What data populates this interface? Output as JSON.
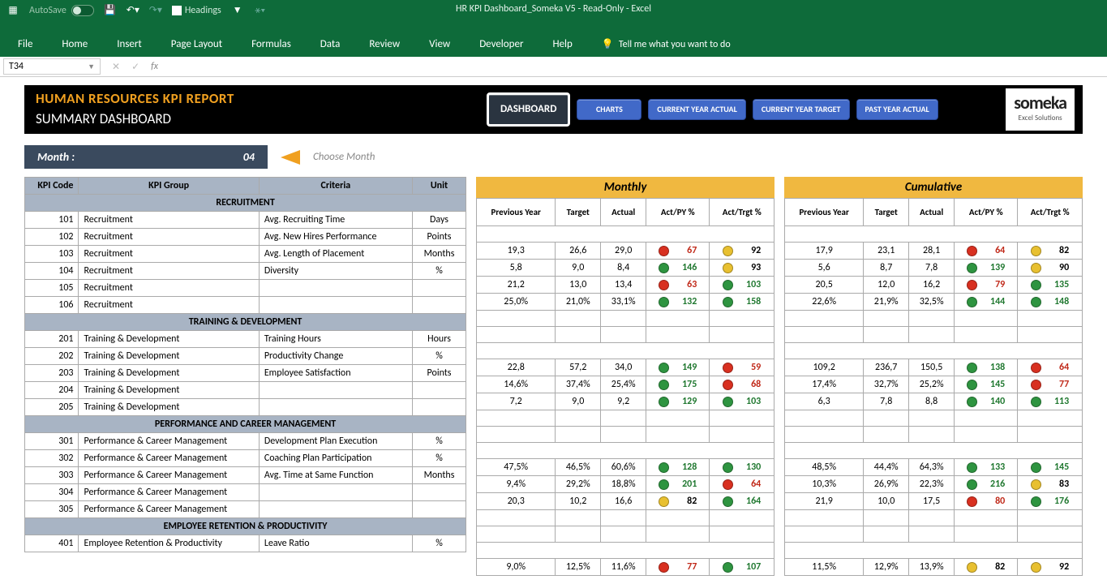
{
  "app": {
    "title": "HR KPI Dashboard_Someka V5  -  Read-Only  -  Excel",
    "autosave": "AutoSave",
    "headings": "Headings",
    "nameBox": "T34",
    "tellMe": "Tell me what you want to do"
  },
  "tabs": [
    "File",
    "Home",
    "Insert",
    "Page Layout",
    "Formulas",
    "Data",
    "Review",
    "View",
    "Developer",
    "Help"
  ],
  "report": {
    "title": "HUMAN RESOURCES KPI REPORT",
    "subtitle": "SUMMARY DASHBOARD"
  },
  "nav": [
    "DASHBOARD",
    "CHARTS",
    "CURRENT YEAR ACTUAL",
    "CURRENT YEAR TARGET",
    "PAST YEAR ACTUAL"
  ],
  "logo": {
    "main": "someka",
    "sub": "Excel Solutions"
  },
  "month": {
    "label": "Month :",
    "value": "04",
    "hint": "Choose Month"
  },
  "cols": {
    "kpiCode": "KPI Code",
    "kpiGroup": "KPI Group",
    "criteria": "Criteria",
    "unit": "Unit",
    "prev": "Previous Year",
    "target": "Target",
    "actual": "Actual",
    "actPy": "Act/PY %",
    "actTrgt": "Act/Trgt %"
  },
  "sections": {
    "monthly": "Monthly",
    "cumulative": "Cumulative"
  },
  "groups": [
    {
      "name": "RECRUITMENT",
      "rows": [
        {
          "code": "101",
          "group": "Recruitment",
          "crit": "Avg. Recruiting Time",
          "unit": "Days",
          "m": {
            "prev": "19,3",
            "target": "26,6",
            "actual": "29,0",
            "py": {
              "v": "67",
              "c": "red",
              "d": "red"
            },
            "tr": {
              "v": "92",
              "c": "black",
              "d": "yellow"
            }
          },
          "c": {
            "prev": "17,9",
            "target": "23,1",
            "actual": "28,1",
            "py": {
              "v": "64",
              "c": "red",
              "d": "red"
            },
            "tr": {
              "v": "82",
              "c": "black",
              "d": "yellow"
            }
          }
        },
        {
          "code": "102",
          "group": "Recruitment",
          "crit": "Avg. New Hires Performance",
          "unit": "Points",
          "m": {
            "prev": "5,8",
            "target": "9,0",
            "actual": "8,4",
            "py": {
              "v": "146",
              "c": "green",
              "d": "green"
            },
            "tr": {
              "v": "93",
              "c": "black",
              "d": "yellow"
            }
          },
          "c": {
            "prev": "5,6",
            "target": "8,7",
            "actual": "7,8",
            "py": {
              "v": "139",
              "c": "green",
              "d": "green"
            },
            "tr": {
              "v": "90",
              "c": "black",
              "d": "yellow"
            }
          }
        },
        {
          "code": "103",
          "group": "Recruitment",
          "crit": "Avg. Length of Placement",
          "unit": "Months",
          "m": {
            "prev": "21,2",
            "target": "13,0",
            "actual": "13,4",
            "py": {
              "v": "63",
              "c": "red",
              "d": "red"
            },
            "tr": {
              "v": "103",
              "c": "green",
              "d": "green"
            }
          },
          "c": {
            "prev": "20,5",
            "target": "12,0",
            "actual": "16,2",
            "py": {
              "v": "79",
              "c": "red",
              "d": "red"
            },
            "tr": {
              "v": "135",
              "c": "green",
              "d": "green"
            }
          }
        },
        {
          "code": "104",
          "group": "Recruitment",
          "crit": "Diversity",
          "unit": "%",
          "m": {
            "prev": "25,0%",
            "target": "21,0%",
            "actual": "33,1%",
            "py": {
              "v": "132",
              "c": "green",
              "d": "green"
            },
            "tr": {
              "v": "158",
              "c": "green",
              "d": "green"
            }
          },
          "c": {
            "prev": "22,6%",
            "target": "21,9%",
            "actual": "32,5%",
            "py": {
              "v": "144",
              "c": "green",
              "d": "green"
            },
            "tr": {
              "v": "148",
              "c": "green",
              "d": "green"
            }
          }
        },
        {
          "code": "105",
          "group": "Recruitment",
          "crit": "",
          "unit": "",
          "m": null,
          "c": null
        },
        {
          "code": "106",
          "group": "Recruitment",
          "crit": "",
          "unit": "",
          "m": null,
          "c": null
        }
      ]
    },
    {
      "name": "TRAINING & DEVELOPMENT",
      "rows": [
        {
          "code": "201",
          "group": "Training & Development",
          "crit": "Training Hours",
          "unit": "Hours",
          "m": {
            "prev": "22,8",
            "target": "57,2",
            "actual": "34,0",
            "py": {
              "v": "149",
              "c": "green",
              "d": "green"
            },
            "tr": {
              "v": "59",
              "c": "red",
              "d": "red"
            }
          },
          "c": {
            "prev": "109,2",
            "target": "236,7",
            "actual": "150,5",
            "py": {
              "v": "138",
              "c": "green",
              "d": "green"
            },
            "tr": {
              "v": "64",
              "c": "red",
              "d": "red"
            }
          }
        },
        {
          "code": "202",
          "group": "Training & Development",
          "crit": "Productivity Change",
          "unit": "%",
          "m": {
            "prev": "14,6%",
            "target": "37,4%",
            "actual": "25,4%",
            "py": {
              "v": "175",
              "c": "green",
              "d": "green"
            },
            "tr": {
              "v": "68",
              "c": "red",
              "d": "red"
            }
          },
          "c": {
            "prev": "17,4%",
            "target": "32,7%",
            "actual": "25,2%",
            "py": {
              "v": "145",
              "c": "green",
              "d": "green"
            },
            "tr": {
              "v": "77",
              "c": "red",
              "d": "red"
            }
          }
        },
        {
          "code": "203",
          "group": "Training & Development",
          "crit": "Employee Satisfaction",
          "unit": "Points",
          "m": {
            "prev": "7,2",
            "target": "9,0",
            "actual": "9,2",
            "py": {
              "v": "129",
              "c": "green",
              "d": "green"
            },
            "tr": {
              "v": "103",
              "c": "green",
              "d": "green"
            }
          },
          "c": {
            "prev": "6,3",
            "target": "7,8",
            "actual": "8,8",
            "py": {
              "v": "140",
              "c": "green",
              "d": "green"
            },
            "tr": {
              "v": "113",
              "c": "green",
              "d": "green"
            }
          }
        },
        {
          "code": "204",
          "group": "Training & Development",
          "crit": "",
          "unit": "",
          "m": null,
          "c": null
        },
        {
          "code": "205",
          "group": "Training & Development",
          "crit": "",
          "unit": "",
          "m": null,
          "c": null
        }
      ]
    },
    {
      "name": "PERFORMANCE AND CAREER MANAGEMENT",
      "rows": [
        {
          "code": "301",
          "group": "Performance & Career Management",
          "crit": "Development Plan Execution",
          "unit": "%",
          "m": {
            "prev": "47,5%",
            "target": "46,5%",
            "actual": "60,6%",
            "py": {
              "v": "128",
              "c": "green",
              "d": "green"
            },
            "tr": {
              "v": "130",
              "c": "green",
              "d": "green"
            }
          },
          "c": {
            "prev": "48,5%",
            "target": "44,4%",
            "actual": "64,3%",
            "py": {
              "v": "133",
              "c": "green",
              "d": "green"
            },
            "tr": {
              "v": "145",
              "c": "green",
              "d": "green"
            }
          }
        },
        {
          "code": "302",
          "group": "Performance & Career Management",
          "crit": "Coaching Plan Participation",
          "unit": "%",
          "m": {
            "prev": "9,4%",
            "target": "29,2%",
            "actual": "18,8%",
            "py": {
              "v": "201",
              "c": "green",
              "d": "green"
            },
            "tr": {
              "v": "64",
              "c": "red",
              "d": "red"
            }
          },
          "c": {
            "prev": "10,3%",
            "target": "26,9%",
            "actual": "22,3%",
            "py": {
              "v": "216",
              "c": "green",
              "d": "green"
            },
            "tr": {
              "v": "83",
              "c": "black",
              "d": "yellow"
            }
          }
        },
        {
          "code": "303",
          "group": "Performance & Career Management",
          "crit": "Avg. Time at Same Function",
          "unit": "Months",
          "m": {
            "prev": "20,3",
            "target": "10,2",
            "actual": "16,6",
            "py": {
              "v": "82",
              "c": "black",
              "d": "yellow"
            },
            "tr": {
              "v": "164",
              "c": "green",
              "d": "green"
            }
          },
          "c": {
            "prev": "21,9",
            "target": "10,0",
            "actual": "17,5",
            "py": {
              "v": "80",
              "c": "red",
              "d": "red"
            },
            "tr": {
              "v": "176",
              "c": "green",
              "d": "green"
            }
          }
        },
        {
          "code": "304",
          "group": "Performance & Career Management",
          "crit": "",
          "unit": "",
          "m": null,
          "c": null
        },
        {
          "code": "305",
          "group": "Performance & Career Management",
          "crit": "",
          "unit": "",
          "m": null,
          "c": null
        }
      ]
    },
    {
      "name": "EMPLOYEE RETENTION & PRODUCTIVITY",
      "rows": [
        {
          "code": "401",
          "group": "Employee Retention & Productivity",
          "crit": "Leave Ratio",
          "unit": "%",
          "m": {
            "prev": "9,0%",
            "target": "12,5%",
            "actual": "11,6%",
            "py": {
              "v": "77",
              "c": "red",
              "d": "red"
            },
            "tr": {
              "v": "107",
              "c": "green",
              "d": "green"
            }
          },
          "c": {
            "prev": "11,5%",
            "target": "12,9%",
            "actual": "13,9%",
            "py": {
              "v": "82",
              "c": "black",
              "d": "yellow"
            },
            "tr": {
              "v": "92",
              "c": "black",
              "d": "yellow"
            }
          }
        }
      ]
    }
  ]
}
